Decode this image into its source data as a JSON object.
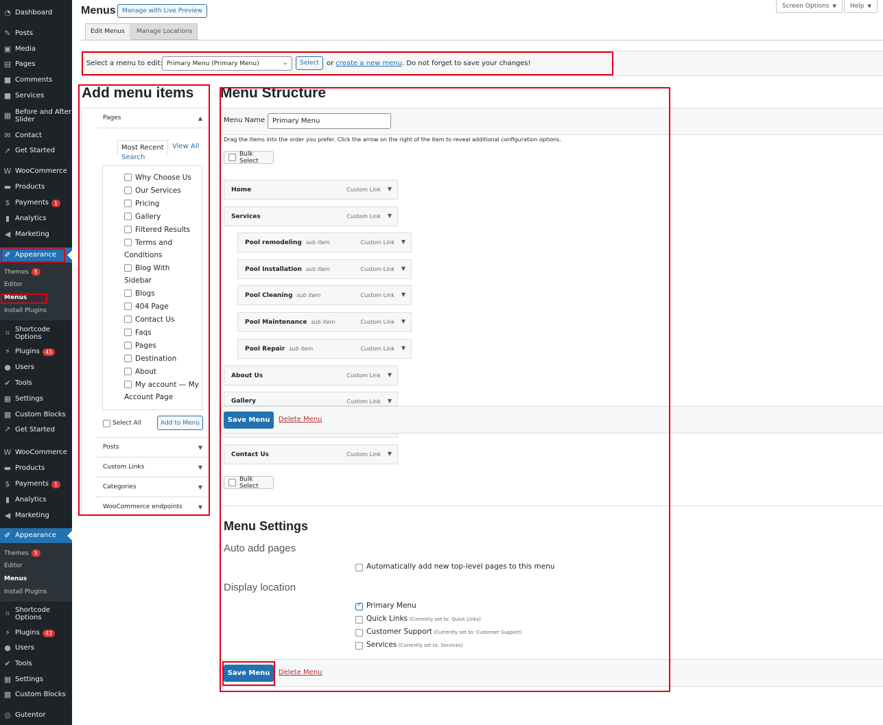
{
  "sidebar": {
    "top": [
      {
        "label": "Dashboard",
        "icon": "dashboard-icon"
      },
      {
        "label": "Posts",
        "icon": "pin-icon"
      },
      {
        "label": "Media",
        "icon": "media-icon"
      },
      {
        "label": "Pages",
        "icon": "page-icon"
      },
      {
        "label": "Comments",
        "icon": "comment-icon"
      },
      {
        "label": "Services",
        "icon": "services-icon"
      },
      {
        "label": "Before and After Slider",
        "icon": "slider-icon"
      },
      {
        "label": "Contact",
        "icon": "mail-icon"
      },
      {
        "label": "Get Started",
        "icon": "rocket-icon"
      },
      {
        "label": "WooCommerce",
        "icon": "woo-icon"
      },
      {
        "label": "Products",
        "icon": "archive-icon"
      },
      {
        "label": "Payments",
        "icon": "dollar-icon",
        "badge": "1"
      },
      {
        "label": "Analytics",
        "icon": "chart-icon"
      },
      {
        "label": "Marketing",
        "icon": "megaphone-icon"
      },
      {
        "label": "Appearance",
        "icon": "brush-icon"
      }
    ],
    "sub1": [
      {
        "label": "Themes",
        "badge": "5"
      },
      {
        "label": "Editor"
      },
      {
        "label": "Menus"
      },
      {
        "label": "Install Plugins"
      }
    ],
    "mid": [
      {
        "label": "Shortcode Options",
        "icon": "shortcode-icon"
      },
      {
        "label": "Plugins",
        "icon": "plugin-icon",
        "badge": "43"
      },
      {
        "label": "Users",
        "icon": "user-icon"
      },
      {
        "label": "Tools",
        "icon": "wrench-icon"
      },
      {
        "label": "Settings",
        "icon": "settings-icon"
      },
      {
        "label": "Custom Blocks",
        "icon": "blocks-icon"
      },
      {
        "label": "Get Started",
        "icon": "rocket-icon"
      },
      {
        "label": "WooCommerce",
        "icon": "woo-icon"
      },
      {
        "label": "Products",
        "icon": "archive-icon"
      },
      {
        "label": "Payments",
        "icon": "dollar-icon",
        "badge": "1"
      },
      {
        "label": "Analytics",
        "icon": "chart-icon"
      },
      {
        "label": "Marketing",
        "icon": "megaphone-icon"
      },
      {
        "label": "Appearance",
        "icon": "brush-icon"
      }
    ],
    "sub2": [
      {
        "label": "Themes",
        "badge": "5"
      },
      {
        "label": "Editor"
      },
      {
        "label": "Menus"
      },
      {
        "label": "Install Plugins"
      }
    ],
    "bottom": [
      {
        "label": "Shortcode Options",
        "icon": "shortcode-icon"
      },
      {
        "label": "Plugins",
        "icon": "plugin-icon",
        "badge": "43"
      },
      {
        "label": "Users",
        "icon": "user-icon"
      },
      {
        "label": "Tools",
        "icon": "wrench-icon"
      },
      {
        "label": "Settings",
        "icon": "settings-icon"
      },
      {
        "label": "Custom Blocks",
        "icon": "blocks-icon"
      },
      {
        "label": "Gutentor",
        "icon": "gutentor-icon"
      }
    ]
  },
  "header": {
    "title": "Menus",
    "live_preview": "Manage with Live Preview",
    "screen_options": "Screen Options",
    "help": "Help",
    "tab_edit": "Edit Menus",
    "tab_locations": "Manage Locations"
  },
  "select_bar": {
    "label": "Select a menu to edit:",
    "selected": "Primary Menu (Primary Menu)",
    "button": "Select",
    "or": "or",
    "create_link": "create a new menu",
    "suffix": ". Do not forget to save your changes!"
  },
  "add_items": {
    "title": "Add menu items",
    "pages_head": "Pages",
    "tab_recent": "Most Recent",
    "tab_viewall": "View All",
    "tab_search": "Search",
    "pages": [
      "Why Choose Us",
      "Our Services",
      "Pricing",
      "Gallery",
      "Filtered Results",
      "Terms and Conditions",
      "Blog With Sidebar",
      "Blogs",
      "404 Page",
      "Contact Us",
      "Faqs",
      "Pages",
      "Destination",
      "About",
      "My account — My Account Page"
    ],
    "pages_lines": [
      [
        "Why Choose Us"
      ],
      [
        "Our Services"
      ],
      [
        "Pricing"
      ],
      [
        "Gallery"
      ],
      [
        "Filtered Results"
      ],
      [
        "Terms and",
        "Conditions"
      ],
      [
        "Blog With",
        "Sidebar"
      ],
      [
        "Blogs"
      ],
      [
        "404 Page"
      ],
      [
        "Contact Us"
      ],
      [
        "Faqs"
      ],
      [
        "Pages"
      ],
      [
        "Destination"
      ],
      [
        "About"
      ],
      [
        "My account — My",
        "Account Page"
      ]
    ],
    "select_all": "Select All",
    "add_button": "Add to Menu",
    "posts_head": "Posts",
    "custom_links_head": "Custom Links",
    "categories_head": "Categories",
    "woo_endpoints_head": "WooCommerce endpoints"
  },
  "structure": {
    "title": "Menu Structure",
    "name_label": "Menu Name",
    "name_value": "Primary Menu",
    "help": "Drag the items into the order you prefer. Click the arrow on the right of the item to reveal additional configuration options.",
    "bulk_select": "Bulk Select",
    "type_label": "Custom Link",
    "sub_label": "sub item",
    "items": [
      {
        "title": "Home",
        "sub": false
      },
      {
        "title": "Services",
        "sub": false
      },
      {
        "title": "Pool remodeling",
        "sub": true
      },
      {
        "title": "Pool Installation",
        "sub": true
      },
      {
        "title": "Pool Cleaning",
        "sub": true
      },
      {
        "title": "Pool Maintenance",
        "sub": true
      },
      {
        "title": "Pool Repair",
        "sub": true
      },
      {
        "title": "About Us",
        "sub": false
      },
      {
        "title": "Gallery",
        "sub": false
      },
      {
        "title": "Contact Us",
        "sub": false
      }
    ],
    "save": "Save Menu",
    "delete": "Delete Menu"
  },
  "settings": {
    "title": "Menu Settings",
    "auto_add": "Auto add pages",
    "auto_add_option": "Automatically add new top-level pages to this menu",
    "display_location": "Display location",
    "locations": [
      {
        "label": "Primary Menu",
        "note": "",
        "checked": true
      },
      {
        "label": "Quick Links",
        "note": "(Currently set to: Quick Links)",
        "checked": false
      },
      {
        "label": "Customer Support",
        "note": "(Currently set to: Customer Support)",
        "checked": false
      },
      {
        "label": "Services",
        "note": "(Currently set to: Services)",
        "checked": false
      }
    ]
  },
  "colors": {
    "sidebar_bg": "#1d2327",
    "accent": "#2271b1",
    "highlight": "#e0001a",
    "delete": "#b32d2e"
  }
}
